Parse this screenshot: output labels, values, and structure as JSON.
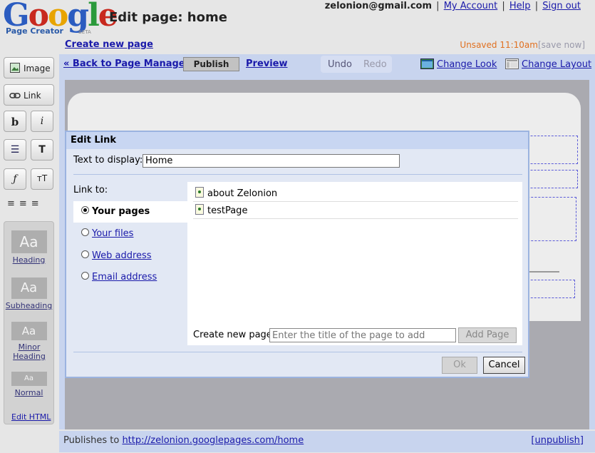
{
  "header": {
    "logo_text": "Google",
    "logo_sub": "Page Creator",
    "logo_beta": "BETA",
    "page_title": "Edit page: home",
    "email": "zelonion@gmail.com",
    "my_account": "My Account",
    "help": "Help",
    "sign_out": "Sign out",
    "separator": "|",
    "create_new_page": "Create new page",
    "unsaved": "Unsaved 11:10am",
    "save_now": "[save now]"
  },
  "toolbar": {
    "back": "« Back to Page Manager",
    "publish": "Publish",
    "preview": "Preview",
    "undo": "Undo",
    "redo": "Redo",
    "change_look": "Change Look",
    "change_layout": "Change Layout"
  },
  "sidebar": {
    "image": "Image",
    "link": "Link",
    "bold": "b",
    "italic": "i",
    "list_glyph": "☰",
    "text_color_glyph": "T",
    "font_glyph": "ƒ",
    "font_size_glyph": "тT",
    "align_glyphs": "≡≡≡",
    "styles": [
      {
        "sample": "Aa",
        "name": "Heading"
      },
      {
        "sample": "Aa",
        "name": "Subheading"
      },
      {
        "sample": "Aa",
        "name": "Minor Heading"
      },
      {
        "sample": "Aa",
        "name": "Normal"
      }
    ],
    "edit_html": "Edit HTML"
  },
  "dialog": {
    "title": "Edit Link",
    "text_label": "Text to display:",
    "text_value": "Home",
    "link_to_label": "Link to:",
    "options": [
      {
        "label": "Your pages",
        "selected": true
      },
      {
        "label": "Your files",
        "selected": false
      },
      {
        "label": "Web address",
        "selected": false
      },
      {
        "label": "Email address",
        "selected": false
      }
    ],
    "pages": [
      "about Zelonion",
      "testPage"
    ],
    "create_page_label": "Create new page:",
    "create_page_placeholder": "Enter the title of the page to add",
    "add_page": "Add Page",
    "ok": "Ok",
    "cancel": "Cancel"
  },
  "footer": {
    "publishes_to_label": "Publishes to",
    "url": "http://zelonion.googlepages.com/home",
    "unpublish": "[unpublish]"
  },
  "colors": {
    "toolbar_bg": "#c8d4ee",
    "link": "#1a1aaa",
    "unsaved": "#e07020",
    "dialog_border": "#9bb3e0"
  }
}
